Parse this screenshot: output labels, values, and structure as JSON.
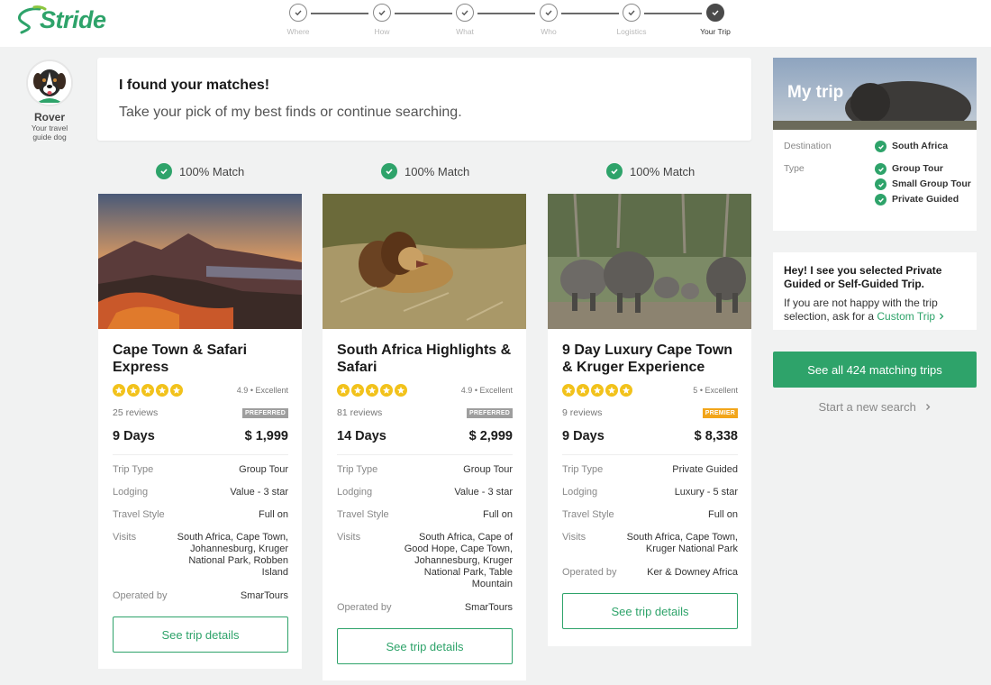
{
  "brand": {
    "name": "Stride",
    "color": "#2ea36a"
  },
  "stepper": {
    "steps": [
      {
        "label": "Where",
        "done": true,
        "active": false
      },
      {
        "label": "How",
        "done": true,
        "active": false
      },
      {
        "label": "What",
        "done": true,
        "active": false
      },
      {
        "label": "Who",
        "done": true,
        "active": false
      },
      {
        "label": "Logistics",
        "done": true,
        "active": false
      },
      {
        "label": "Your Trip",
        "done": true,
        "active": true
      }
    ]
  },
  "assistant": {
    "name": "Rover",
    "subtitle_line1": "Your travel",
    "subtitle_line2": "guide dog"
  },
  "matches": {
    "title": "I found your matches!",
    "subtitle": "Take your pick of my best finds or continue searching."
  },
  "trips": [
    {
      "match_label": "100% Match",
      "title": "Cape Town & Safari Express",
      "rating": "4.9",
      "rating_word": "Excellent",
      "reviews": "25 reviews",
      "tag": "PREFERRED",
      "days": "9 Days",
      "price": "$ 1,999",
      "trip_type_label": "Trip Type",
      "trip_type": "Group Tour",
      "lodging_label": "Lodging",
      "lodging": "Value - 3 star",
      "style_label": "Travel Style",
      "style": "Full on",
      "visits_label": "Visits",
      "visits": "South Africa, Cape Town, Johannesburg, Kruger National Park, Robben Island",
      "operator_label": "Operated by",
      "operator": "SmarTours",
      "button": "See trip details",
      "image": "sunset-mountain-photo"
    },
    {
      "match_label": "100% Match",
      "title": "South Africa Highlights & Safari",
      "rating": "4.9",
      "rating_word": "Excellent",
      "reviews": "81 reviews",
      "tag": "PREFERRED",
      "days": "14 Days",
      "price": "$ 2,999",
      "trip_type_label": "Trip Type",
      "trip_type": "Group Tour",
      "lodging_label": "Lodging",
      "lodging": "Value - 3 star",
      "style_label": "Travel Style",
      "style": "Full on",
      "visits_label": "Visits",
      "visits": "South Africa, Cape of Good Hope, Cape Town, Johannesburg, Kruger National Park, Table Mountain",
      "operator_label": "Operated by",
      "operator": "SmarTours",
      "button": "See trip details",
      "image": "lion-photo"
    },
    {
      "match_label": "100% Match",
      "title": "9 Day Luxury Cape Town & Kruger Experience",
      "rating": "5",
      "rating_word": "Excellent",
      "reviews": "9 reviews",
      "tag": "PREMIER",
      "days": "9 Days",
      "price": "$ 8,338",
      "trip_type_label": "Trip Type",
      "trip_type": "Private Guided",
      "lodging_label": "Lodging",
      "lodging": "Luxury - 5 star",
      "style_label": "Travel Style",
      "style": "Full on",
      "visits_label": "Visits",
      "visits": "South Africa, Cape Town, Kruger National Park",
      "operator_label": "Operated by",
      "operator": "Ker & Downey Africa",
      "button": "See trip details",
      "image": "elephants-photo"
    }
  ],
  "my_trip": {
    "title": "My trip",
    "destination_label": "Destination",
    "destination": "South Africa",
    "type_label": "Type",
    "types": [
      "Group Tour",
      "Small Group Tour",
      "Private Guided"
    ]
  },
  "notice": {
    "bold": "Hey! I see you selected Private Guided or Self-Guided Trip.",
    "text": "If you are not happy with the trip selection, ask for a ",
    "link": "Custom Trip"
  },
  "actions": {
    "see_all": "See all 424 matching trips",
    "new_search": "Start a new search"
  },
  "colors": {
    "accent": "#2ea36a",
    "star": "#f2c21b",
    "premier": "#f2a51a",
    "preferred": "#9e9e9e"
  }
}
